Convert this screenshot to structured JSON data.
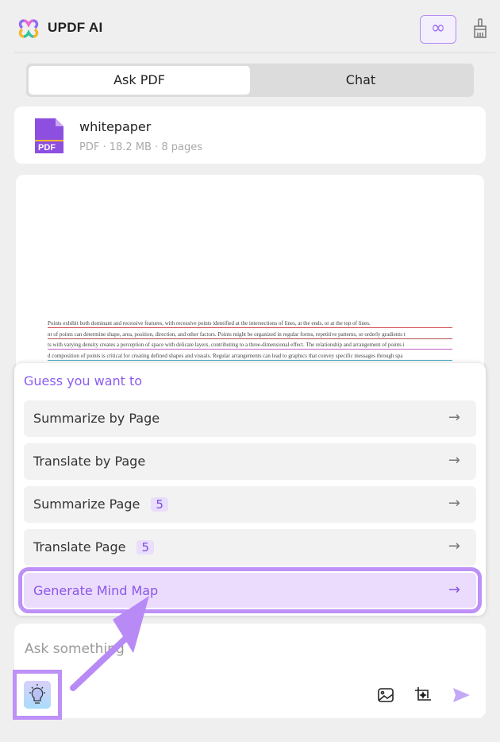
{
  "header": {
    "title": "UPDF AI",
    "infinity_icon": "infinity-icon",
    "clear_icon": "brush-icon"
  },
  "tabs": [
    {
      "label": "Ask PDF",
      "active": true
    },
    {
      "label": "Chat",
      "active": false
    }
  ],
  "file": {
    "name": "whitepaper",
    "meta": "PDF · 18.2 MB · 8 pages",
    "icon_label": "PDF"
  },
  "preview": {
    "lines": [
      "Points exhibit both dominant and recessive features, with recessive points identified at the intersections of lines, at the ends, or at the top of lines.",
      "nt of points can determine shape, area, position, direction, and other factors. Points might be organized in regular forms, repetitive patterns, or orderly gradients t",
      "ts with varying density creates a perception of space with delicate layers, contributing to a three-dimensional effect. The relationship and arrangement of points i",
      "d composition of points is critical for creating defined shapes and visuals. Regular arrangements can lead to graphics that convey specific messages through spa"
    ]
  },
  "suggestions": {
    "title": "Guess you want to",
    "items": [
      {
        "label": "Summarize by Page"
      },
      {
        "label": "Translate by Page"
      },
      {
        "label": "Summarize Page",
        "badge": "5"
      },
      {
        "label": "Translate Page",
        "badge": "5"
      },
      {
        "label": "Generate Mind Map",
        "highlighted": true
      }
    ],
    "arrow": "→"
  },
  "input": {
    "placeholder": "Ask something"
  },
  "colors": {
    "accent": "#8a5cf0",
    "highlight": "#bd91f7"
  }
}
